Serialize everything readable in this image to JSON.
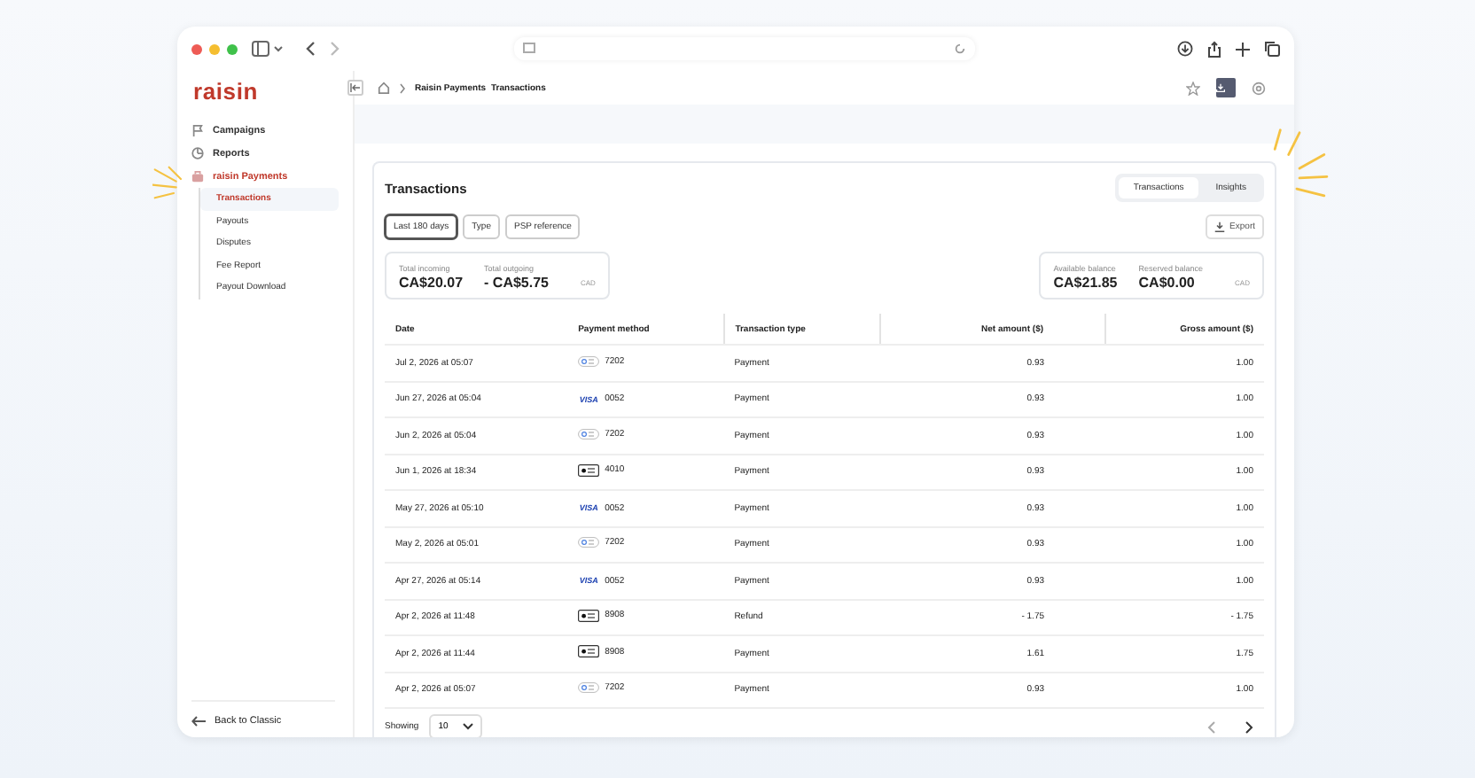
{
  "sidebar": {
    "logo": "raisin",
    "items": [
      {
        "label": "Campaigns",
        "selected": false
      },
      {
        "label": "Reports",
        "selected": false
      },
      {
        "label": "raisin Payments",
        "selected": true,
        "children": [
          {
            "label": "Transactions",
            "selected": true
          },
          {
            "label": "Payouts",
            "selected": false
          },
          {
            "label": "Disputes",
            "selected": false
          },
          {
            "label": "Fee Report",
            "selected": false
          },
          {
            "label": "Payout Download",
            "selected": false
          }
        ]
      }
    ],
    "back_link": "Back to Classic"
  },
  "breadcrumb": [
    "Raisin Payments",
    "Transactions"
  ],
  "card": {
    "title": "Transactions",
    "tabs": [
      {
        "label": "Transactions",
        "selected": true
      },
      {
        "label": "Insights",
        "selected": false
      }
    ],
    "filters": [
      {
        "label": "Last 180 days",
        "selected": true
      },
      {
        "label": "Type",
        "selected": false
      },
      {
        "label": "PSP reference",
        "selected": false
      }
    ],
    "export": "Export",
    "totals": {
      "items": [
        {
          "label": "Total incoming",
          "value": "CA$20.07"
        },
        {
          "label": "Total outgoing",
          "value": "- CA$5.75"
        }
      ],
      "currency": "CAD"
    },
    "balances": {
      "items": [
        {
          "label": "Available balance",
          "value": "CA$21.85"
        },
        {
          "label": "Reserved balance",
          "value": "CA$0.00"
        }
      ],
      "currency": "CAD"
    }
  },
  "table": {
    "columns": [
      "Date",
      "Payment method",
      "Transaction type",
      "Net amount ($)",
      "Gross amount ($)"
    ],
    "rows": [
      {
        "date": "Jul 2, 2026 at 05:07",
        "kind": "gpay",
        "last4": "7202",
        "type": "Payment",
        "net": "0.93",
        "gross": "1.00"
      },
      {
        "date": "Jun 27, 2026 at 05:04",
        "kind": "visa",
        "brand": "VISA",
        "last4": "0052",
        "type": "Payment",
        "net": "0.93",
        "gross": "1.00"
      },
      {
        "date": "Jun 2, 2026 at 05:04",
        "kind": "gpay",
        "last4": "7202",
        "type": "Payment",
        "net": "0.93",
        "gross": "1.00"
      },
      {
        "date": "Jun 1, 2026 at 18:34",
        "kind": "applepay",
        "last4": "4010",
        "type": "Payment",
        "net": "0.93",
        "gross": "1.00"
      },
      {
        "date": "May 27, 2026 at 05:10",
        "kind": "visa",
        "brand": "VISA",
        "last4": "0052",
        "type": "Payment",
        "net": "0.93",
        "gross": "1.00"
      },
      {
        "date": "May 2, 2026 at 05:01",
        "kind": "gpay",
        "last4": "7202",
        "type": "Payment",
        "net": "0.93",
        "gross": "1.00"
      },
      {
        "date": "Apr 27, 2026 at 05:14",
        "kind": "visa",
        "brand": "VISA",
        "last4": "0052",
        "type": "Payment",
        "net": "0.93",
        "gross": "1.00"
      },
      {
        "date": "Apr 2, 2026 at 11:48",
        "kind": "applepay",
        "last4": "8908",
        "type": "Refund",
        "net": "- 1.75",
        "gross": "- 1.75"
      },
      {
        "date": "Apr 2, 2026 at 11:44",
        "kind": "applepay",
        "last4": "8908",
        "type": "Payment",
        "net": "1.61",
        "gross": "1.75"
      },
      {
        "date": "Apr 2, 2026 at 05:07",
        "kind": "gpay",
        "last4": "7202",
        "type": "Payment",
        "net": "0.93",
        "gross": "1.00"
      }
    ]
  },
  "pagination": {
    "label": "Showing",
    "page_size": "10"
  }
}
